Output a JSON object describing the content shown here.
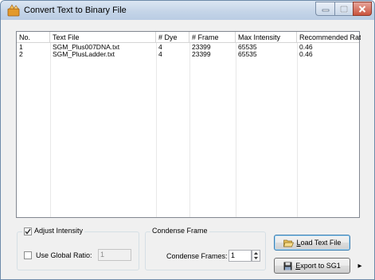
{
  "window": {
    "title": "Convert Text to Binary File",
    "icon": "app-icon"
  },
  "list": {
    "columns": [
      "No.",
      "Text File",
      "# Dye",
      "# Frame",
      "Max Intensity",
      "Recommended Ratio"
    ],
    "rows": [
      {
        "no": "1",
        "file": "SGM_Plus007DNA.txt",
        "dye": "4",
        "frame": "23399",
        "max": "65535",
        "ratio": "0.46"
      },
      {
        "no": "2",
        "file": "SGM_PlusLadder.txt",
        "dye": "4",
        "frame": "23399",
        "max": "65535",
        "ratio": "0.46"
      }
    ]
  },
  "intensity_group": {
    "adjust_label": "Adjust Intensity",
    "adjust_checked": true,
    "global_ratio_label": "Use Global Ratio:",
    "global_ratio_checked": false,
    "global_ratio_value": "1"
  },
  "condense_group": {
    "title": "Condense Frame",
    "frames_label": "Condense Frames:",
    "frames_value": "1"
  },
  "buttons": {
    "load_prefix": "",
    "load_accel": "L",
    "load_rest": "oad Text File",
    "export_accel": "E",
    "export_rest": "xport to SG1",
    "more_arrow": "▸"
  }
}
